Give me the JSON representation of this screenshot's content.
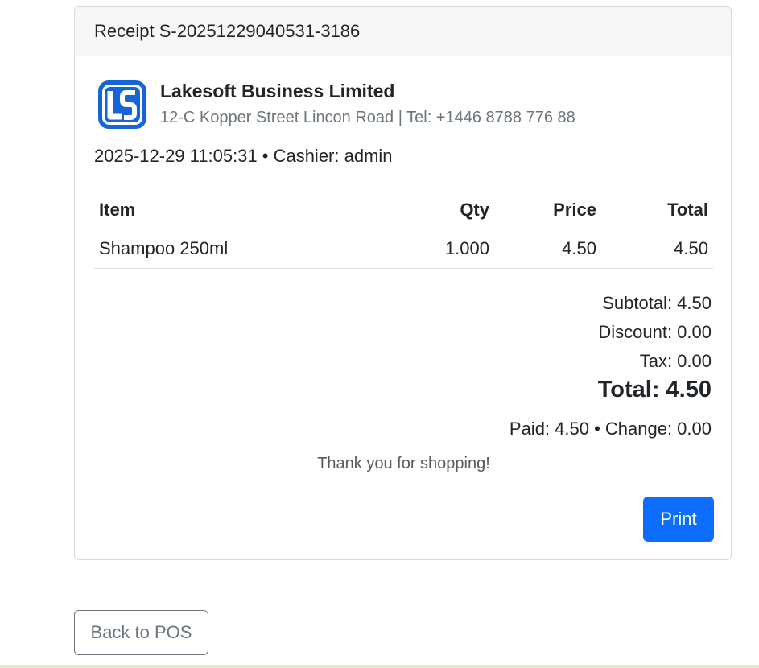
{
  "receipt": {
    "header_title": "Receipt S-20251229040531-3186",
    "business_name": "Lakesoft Business Limited",
    "business_address": "12-C Kopper Street Lincon Road | Tel: +1446 8788 776 88",
    "meta_line": "2025-12-29 11:05:31 • Cashier: admin",
    "logo_icon": "lakesoft-logo-icon",
    "columns": [
      "Item",
      "Qty",
      "Price",
      "Total"
    ],
    "rows": [
      {
        "item": "Shampoo 250ml",
        "qty": "1.000",
        "price": "4.50",
        "total": "4.50"
      }
    ],
    "subtotal": "Subtotal: 4.50",
    "discount": "Discount: 0.00",
    "tax": "Tax: 0.00",
    "grand_total": "Total: 4.50",
    "paid_change": "Paid: 4.50 • Change: 0.00",
    "thank_you": "Thank you for shopping!",
    "print_label": "Print"
  },
  "back_label": "Back to POS",
  "colors": {
    "primary": "#0d6efd",
    "secondary": "#6c757d",
    "header_bg": "#f7f7f7",
    "logo_blue": "#1565d8"
  }
}
